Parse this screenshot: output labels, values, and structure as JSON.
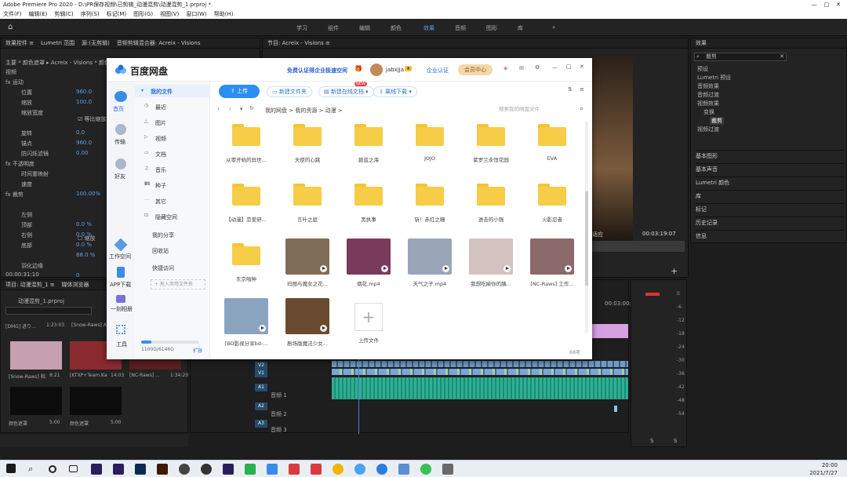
{
  "app": {
    "title": "Adobe Premiere Pro 2020 - D:\\PR保存视频\\已剪辑_动漫混剪\\动漫混剪_1.prproj *",
    "menu": [
      "文件(F)",
      "编辑(E)",
      "剪辑(C)",
      "序列(S)",
      "标记(M)",
      "图形(G)",
      "视图(V)",
      "窗口(W)",
      "帮助(H)"
    ],
    "workspaces": [
      "学习",
      "组件",
      "编辑",
      "颜色",
      "效果",
      "音频",
      "图形",
      "库"
    ],
    "active_workspace": "效果"
  },
  "effect_controls": {
    "tabs": [
      "效果控件 ≡",
      "Lumetri 范围",
      "源:(无剪辑)",
      "音频剪辑混合器: Acreix - Visions"
    ],
    "subtitle": "主要 * 颜色遮罩 ▸ Acreix - Visions * 颜色遮罩",
    "rows": [
      "视频",
      "fx 运动",
      "位置",
      "缩放",
      "缩放宽度",
      "",
      "旋转",
      "锚点",
      "防闪烁滤镜",
      "fx 不透明度",
      "时间重映射",
      "速度",
      "fx 裁剪",
      "",
      "左侧",
      "顶部",
      "右侧",
      "底部",
      "",
      "羽化边缘"
    ],
    "values": [
      "960.0",
      "100.0",
      "",
      "",
      "0.0",
      "960.0",
      "0.00",
      "",
      "",
      "",
      "100.00%",
      "",
      "",
      "0.0 %",
      "0.0 %",
      "0.0 %",
      "88.0 %",
      "",
      "0"
    ],
    "extra": [
      "等比缩放",
      "缩放"
    ],
    "timecode": "00:00:31:10"
  },
  "program": {
    "title": "节目: Acreix - Visions ≡",
    "zoom": "适应",
    "time": "00:03:19:07"
  },
  "project": {
    "tabs": [
      "项目: 动漫混剪_1 ≡",
      "媒体浏览器"
    ],
    "file": "动漫混剪_1.prproj",
    "items": [
      {
        "name": "[DMG] 进り...",
        "dur": "1:23:03"
      },
      {
        "name": "[Snow-Raws] Angel",
        "dur": ""
      },
      {
        "name": "[Snow-Raws] 和...",
        "dur": "8:21"
      },
      {
        "name": "[KTXP+Team.Kaga...",
        "dur": "14:03"
      },
      {
        "name": "[NC-Raws] ...",
        "dur": "1:34:20"
      },
      {
        "name": "颜色遮罩",
        "dur": "5:00"
      },
      {
        "name": "颜色遮罩",
        "dur": "5:00"
      }
    ]
  },
  "effects": {
    "title": "效果",
    "search": "裁剪",
    "tree": [
      "预设",
      "Lumetri 预设",
      "音频效果",
      "音频过渡",
      "视频效果",
      "变换",
      "裁剪",
      "视频过渡"
    ],
    "panels": [
      "基本图形",
      "基本声音",
      "Lumetri 颜色",
      "库",
      "标记",
      "历史记录",
      "信息"
    ]
  },
  "timeline": {
    "tracks": [
      "V2",
      "V1",
      "A1",
      "A2",
      "A3"
    ],
    "track_names": [
      "音频 1",
      "音频 2",
      "音频 3"
    ],
    "time": "00:03:00:0"
  },
  "meter": {
    "labels": [
      "0",
      "-6",
      "-12",
      "-18",
      "-24",
      "-30",
      "-36",
      "-42",
      "-48",
      "-54"
    ],
    "solo": "S"
  },
  "baidu": {
    "title": "百度网盘",
    "promo": "免费认证得企业极速空间",
    "user": "jabxjja",
    "enterprise": "企业认证",
    "vip": "会员中心",
    "left": [
      "首页",
      "传输",
      "好友",
      "工作空间",
      "APP下载",
      "一刻相册",
      "工具"
    ],
    "nav": [
      "我的文件",
      "最近",
      "图片",
      "视频",
      "文档",
      "音乐",
      "种子",
      "其它",
      "隐藏空间",
      "我的分享",
      "回收站",
      "快捷访问",
      "+ 拖入常用文件夹"
    ],
    "upload": "上传",
    "new_folder": "新建文件夹",
    "new_doc": "新建在线文档",
    "new_badge": "NEW",
    "offline": "离线下载",
    "breadcrumb": [
      "我的网盘",
      "我的资源",
      "动漫"
    ],
    "search_placeholder": "搜索我的网盘文件",
    "files": [
      "从零开始的异世...",
      "天使的心跳",
      "碧蓝之海",
      "JOJO",
      "紫罗兰永恒花园",
      "EVA",
      "【动漫】恋爱研...",
      "言叶之庭",
      "黑执事",
      "斩！赤红之瞳",
      "进击的小强",
      "火影忍者",
      "东京喰种",
      "玛丽与魔女之花...",
      "烟花.mp4",
      "天气之子.mp4",
      "我想吃掉你的胰...",
      "[NC-Raws] 工作...",
      "[BD影视分享bd-...",
      "剧场版魔法少女...",
      "上传文件"
    ],
    "quota": "1100G/6146G",
    "expand": "扩容",
    "count": "68项"
  },
  "tray": {
    "time": "20:00",
    "date": "2021/7/27"
  }
}
